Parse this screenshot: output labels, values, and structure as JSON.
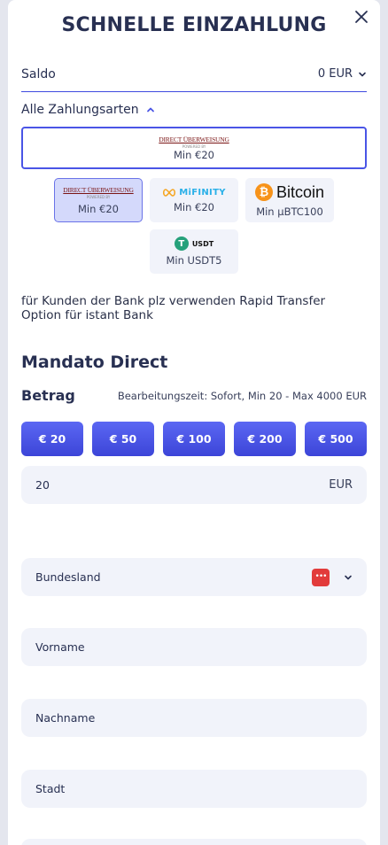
{
  "modal": {
    "title": "SCHNELLE EINZAHLUNG"
  },
  "balance": {
    "label": "Saldo",
    "value": "0 EUR"
  },
  "methods": {
    "header": "Alle Zahlungsarten",
    "selected": {
      "logo_text": "DIRECT ÜBERWEISUNG",
      "logo_sub": "POWERED BY",
      "min": "Min €20"
    },
    "items": [
      {
        "name": "Direct Überweisung",
        "logo_text": "DIRECT ÜBERWEISUNG",
        "logo_sub": "POWERED BY",
        "min": "Min €20",
        "active": true
      },
      {
        "name": "MiFinity",
        "logo_text": "MiFINITY",
        "min": "Min €20",
        "active": false
      },
      {
        "name": "Bitcoin",
        "logo_text": "Bitcoin",
        "min": "Min µBTC100",
        "active": false
      },
      {
        "name": "USDT",
        "logo_text": "USDT",
        "min": "Min USDT5",
        "active": false
      }
    ]
  },
  "notice": "für Kunden der Bank plz verwenden Rapid Transfer Option für istant Bank",
  "method_title": "Mandato Direct",
  "amount": {
    "label": "Betrag",
    "info": "Bearbeitungszeit: Sofort, Min 20 - Max 4000 EUR",
    "presets": [
      "€ 20",
      "€ 50",
      "€ 100",
      "€ 200",
      "€ 500"
    ],
    "value": "20",
    "currency": "EUR"
  },
  "form": {
    "state_label": "Bundesland",
    "first_name_placeholder": "Vorname",
    "last_name_placeholder": "Nachname",
    "city_placeholder": "Stadt"
  },
  "colors": {
    "accent": "#4a55e6",
    "field_bg": "#f1f3fa",
    "title": "#283052"
  }
}
